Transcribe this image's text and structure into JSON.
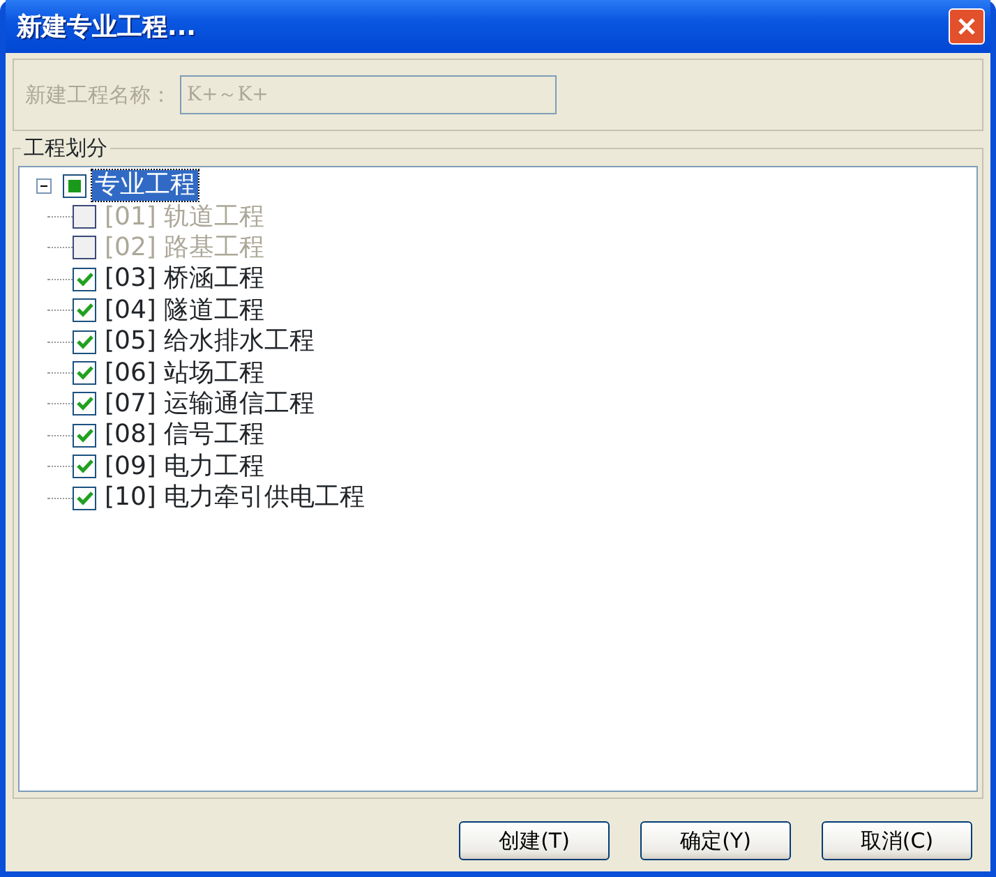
{
  "window": {
    "title": "新建专业工程..."
  },
  "name_field": {
    "label": "新建工程名称：",
    "value": "K+～K+",
    "disabled": true
  },
  "group": {
    "title": "工程划分"
  },
  "tree": {
    "label": "专业工程",
    "expanded": true,
    "selected": true,
    "indeterminate": true,
    "children": [
      {
        "label": "[01] 轨道工程",
        "checked": false,
        "disabled": true
      },
      {
        "label": "[02] 路基工程",
        "checked": false,
        "disabled": true
      },
      {
        "label": "[03] 桥涵工程",
        "checked": true,
        "disabled": false
      },
      {
        "label": "[04] 隧道工程",
        "checked": true,
        "disabled": false
      },
      {
        "label": "[05] 给水排水工程",
        "checked": true,
        "disabled": false
      },
      {
        "label": "[06] 站场工程",
        "checked": true,
        "disabled": false
      },
      {
        "label": "[07] 运输通信工程",
        "checked": true,
        "disabled": false
      },
      {
        "label": "[08] 信号工程",
        "checked": true,
        "disabled": false
      },
      {
        "label": "[09] 电力工程",
        "checked": true,
        "disabled": false
      },
      {
        "label": "[10] 电力牵引供电工程",
        "checked": true,
        "disabled": false
      }
    ]
  },
  "buttons": [
    "创建(T)",
    "确定(Y)",
    "取消(C)"
  ]
}
